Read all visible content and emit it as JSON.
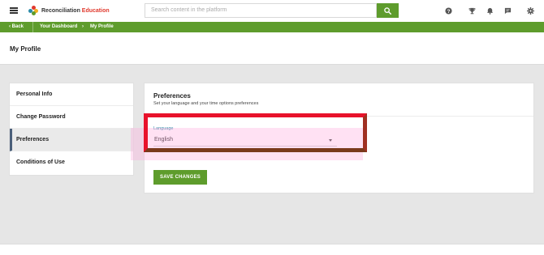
{
  "header": {
    "brand_name": "Reconciliation",
    "brand_suffix": "Education",
    "search": {
      "placeholder": "Search content in the platform"
    },
    "icons": [
      "menu-icon",
      "search-icon",
      "help-icon",
      "trophy-icon",
      "bell-icon",
      "chat-icon",
      "gear-icon"
    ]
  },
  "breadcrumb": {
    "back_label": "Back",
    "items": [
      "Your Dashboard",
      "My Profile"
    ]
  },
  "page": {
    "title": "My Profile"
  },
  "sidebar": {
    "items": [
      {
        "label": "Personal Info",
        "active": false
      },
      {
        "label": "Change Password",
        "active": false
      },
      {
        "label": "Preferences",
        "active": true
      },
      {
        "label": "Conditions of Use",
        "active": false
      }
    ]
  },
  "preferences": {
    "title": "Preferences",
    "subtitle": "Set your language and your time options preferences",
    "language_label": "Language",
    "language_value": "English",
    "save_label": "SAVE CHANGES"
  },
  "colors": {
    "accent_green": "#5e9c2c",
    "highlight_red": "#e8122b",
    "label_blue": "#2a8aa8",
    "active_border": "#4a5f7a"
  }
}
